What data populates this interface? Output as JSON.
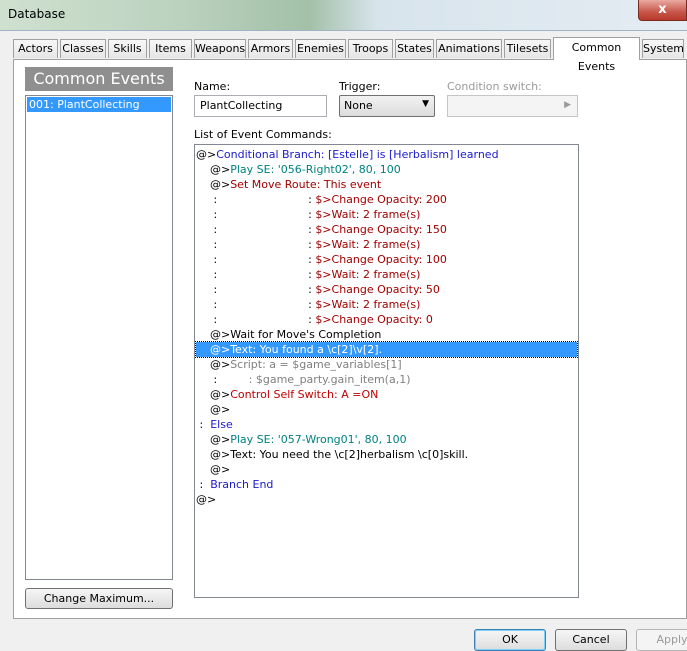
{
  "window": {
    "title": "Database",
    "close_label": "x"
  },
  "tabs": [
    {
      "label": "Actors"
    },
    {
      "label": "Classes"
    },
    {
      "label": "Skills"
    },
    {
      "label": "Items"
    },
    {
      "label": "Weapons"
    },
    {
      "label": "Armors"
    },
    {
      "label": "Enemies"
    },
    {
      "label": "Troops"
    },
    {
      "label": "States"
    },
    {
      "label": "Animations"
    },
    {
      "label": "Tilesets"
    },
    {
      "label": "Common Events",
      "active": true
    },
    {
      "label": "System"
    }
  ],
  "left_panel": {
    "header": "Common Events",
    "items": [
      {
        "label": "001: PlantCollecting",
        "selected": true
      }
    ],
    "change_max_label": "Change Maximum..."
  },
  "fields": {
    "name_label": "Name:",
    "name_value": "PlantCollecting",
    "trigger_label": "Trigger:",
    "trigger_value": "None",
    "condition_label": "Condition switch:",
    "condition_value": ""
  },
  "commands_label": "List of Event Commands:",
  "commands": [
    {
      "prefix": "@>",
      "text": "Conditional Branch: [Estelle] is [Herbalism] learned",
      "color": "#1a1acc"
    },
    {
      "prefix": "    @>",
      "text": "Play SE: '056-Right02', 80, 100",
      "color": "#008080"
    },
    {
      "prefix": "    @>",
      "text": "Set Move Route: This event",
      "color": "#a00000"
    },
    {
      "prefix": "     :                          : ",
      "text": "$>Change Opacity: 200",
      "color": "#a00000"
    },
    {
      "prefix": "     :                          : ",
      "text": "$>Wait: 2 frame(s)",
      "color": "#a00000"
    },
    {
      "prefix": "     :                          : ",
      "text": "$>Change Opacity: 150",
      "color": "#a00000"
    },
    {
      "prefix": "     :                          : ",
      "text": "$>Wait: 2 frame(s)",
      "color": "#a00000"
    },
    {
      "prefix": "     :                          : ",
      "text": "$>Change Opacity: 100",
      "color": "#a00000"
    },
    {
      "prefix": "     :                          : ",
      "text": "$>Wait: 2 frame(s)",
      "color": "#a00000"
    },
    {
      "prefix": "     :                          : ",
      "text": "$>Change Opacity: 50",
      "color": "#a00000"
    },
    {
      "prefix": "     :                          : ",
      "text": "$>Wait: 2 frame(s)",
      "color": "#a00000"
    },
    {
      "prefix": "     :                          : ",
      "text": "$>Change Opacity: 0",
      "color": "#a00000"
    },
    {
      "prefix": "    @>",
      "text": "Wait for Move's Completion",
      "color": "#000000"
    },
    {
      "prefix": "    @>",
      "text": "Text: You found a \\c[2]\\v[2].",
      "color": "#000000",
      "selected": true
    },
    {
      "prefix": "    @>",
      "text": "Script: a = $game_variables[1]",
      "color": "#808080"
    },
    {
      "prefix": "     :         ",
      "text": ": $game_party.gain_item(a,1)",
      "color": "#808080"
    },
    {
      "prefix": "    @>",
      "text": "Control Self Switch: A =ON",
      "color": "#c00000"
    },
    {
      "prefix": "    @>",
      "text": "",
      "color": "#000000"
    },
    {
      "prefix": " :  ",
      "text": "Else",
      "color": "#1a1acc"
    },
    {
      "prefix": "    @>",
      "text": "Play SE: '057-Wrong01', 80, 100",
      "color": "#008080"
    },
    {
      "prefix": "    @>",
      "text": "Text: You need the \\c[2]herbalism \\c[0]skill.",
      "color": "#000000"
    },
    {
      "prefix": "    @>",
      "text": "",
      "color": "#000000"
    },
    {
      "prefix": " :  ",
      "text": "Branch End",
      "color": "#1a1acc"
    },
    {
      "prefix": "@>",
      "text": "",
      "color": "#000000"
    }
  ],
  "buttons": {
    "ok": "OK",
    "cancel": "Cancel",
    "apply": "Apply"
  }
}
